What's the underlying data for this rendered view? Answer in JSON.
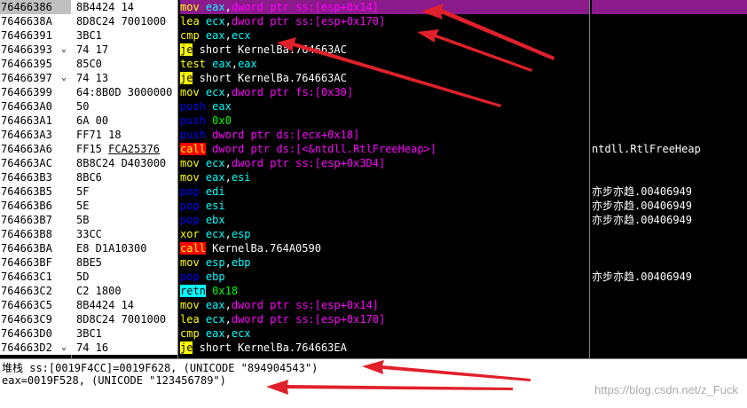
{
  "rows": [
    {
      "addr": "76466386",
      "arrow": "",
      "hex": "8B4424 14",
      "dis": [
        [
          "mov",
          "mn"
        ],
        [
          " ",
          "plain"
        ],
        [
          "eax",
          "op"
        ],
        [
          ",",
          "plain"
        ],
        [
          "dword ptr ss:[esp+0x14]",
          "mem"
        ]
      ],
      "com": "",
      "selected": true
    },
    {
      "addr": "7646638A",
      "arrow": "",
      "hex": "8D8C24 7001000",
      "dis": [
        [
          "lea",
          "mn"
        ],
        [
          " ",
          "plain"
        ],
        [
          "ecx",
          "op"
        ],
        [
          ",",
          "plain"
        ],
        [
          "dword ptr ss:[esp+0x170]",
          "mem"
        ]
      ],
      "com": ""
    },
    {
      "addr": "76466391",
      "arrow": "",
      "hex": "3BC1",
      "dis": [
        [
          "cmp",
          "mn"
        ],
        [
          " ",
          "plain"
        ],
        [
          "eax",
          "op"
        ],
        [
          ",",
          "plain"
        ],
        [
          "ecx",
          "op"
        ]
      ],
      "com": ""
    },
    {
      "addr": "76466393",
      "arrow": "⌄",
      "hex": "74 17",
      "dis": [
        [
          "je",
          "jmp"
        ],
        [
          " short KernelBa.764663AC",
          "plain"
        ]
      ],
      "com": ""
    },
    {
      "addr": "76466395",
      "arrow": "",
      "hex": "85C0",
      "dis": [
        [
          "test",
          "mn"
        ],
        [
          " ",
          "plain"
        ],
        [
          "eax",
          "op"
        ],
        [
          ",",
          "plain"
        ],
        [
          "eax",
          "op"
        ]
      ],
      "com": ""
    },
    {
      "addr": "76466397",
      "arrow": "⌄",
      "hex": "74 13",
      "dis": [
        [
          "je",
          "jmp"
        ],
        [
          " short KernelBa.764663AC",
          "plain"
        ]
      ],
      "com": ""
    },
    {
      "addr": "76466399",
      "arrow": "",
      "hex": "64:8B0D 3000000",
      "dis": [
        [
          "mov",
          "mn"
        ],
        [
          " ",
          "plain"
        ],
        [
          "ecx",
          "op"
        ],
        [
          ",",
          "plain"
        ],
        [
          "dword ptr fs:[0x30]",
          "mem"
        ]
      ],
      "com": ""
    },
    {
      "addr": "764663A0",
      "arrow": "",
      "hex": "50",
      "dis": [
        [
          "push",
          "push"
        ],
        [
          " ",
          "plain"
        ],
        [
          "eax",
          "op"
        ]
      ],
      "com": ""
    },
    {
      "addr": "764663A1",
      "arrow": "",
      "hex": "6A 00",
      "dis": [
        [
          "push",
          "push"
        ],
        [
          " ",
          "plain"
        ],
        [
          "0x0",
          "num"
        ]
      ],
      "com": ""
    },
    {
      "addr": "764663A3",
      "arrow": "",
      "hex": "FF71 18",
      "dis": [
        [
          "push",
          "push"
        ],
        [
          " ",
          "plain"
        ],
        [
          "dword ptr ds:[ecx+0x18]",
          "mem"
        ]
      ],
      "com": ""
    },
    {
      "addr": "764663A6",
      "arrow": "",
      "hex": "FF15 FCA25376",
      "hexul": true,
      "dis": [
        [
          "call",
          "call"
        ],
        [
          " ",
          "plain"
        ],
        [
          "dword ptr ds:[<&ntdll.RtlFreeHeap>]",
          "mem"
        ]
      ],
      "com": "ntdll.RtlFreeHeap"
    },
    {
      "addr": "764663AC",
      "arrow": "",
      "hex": "8B8C24 D403000",
      "dis": [
        [
          "mov",
          "mn"
        ],
        [
          " ",
          "plain"
        ],
        [
          "ecx",
          "op"
        ],
        [
          ",",
          "plain"
        ],
        [
          "dword ptr ss:[esp+0x3D4]",
          "mem"
        ]
      ],
      "com": ""
    },
    {
      "addr": "764663B3",
      "arrow": "",
      "hex": "8BC6",
      "dis": [
        [
          "mov",
          "mn"
        ],
        [
          " ",
          "plain"
        ],
        [
          "eax",
          "op"
        ],
        [
          ",",
          "plain"
        ],
        [
          "esi",
          "op"
        ]
      ],
      "com": ""
    },
    {
      "addr": "764663B5",
      "arrow": "",
      "hex": "5F",
      "dis": [
        [
          "pop",
          "pop"
        ],
        [
          " ",
          "plain"
        ],
        [
          "edi",
          "op"
        ]
      ],
      "com": "亦步亦趋.00406949"
    },
    {
      "addr": "764663B6",
      "arrow": "",
      "hex": "5E",
      "dis": [
        [
          "pop",
          "pop"
        ],
        [
          " ",
          "plain"
        ],
        [
          "esi",
          "op"
        ]
      ],
      "com": "亦步亦趋.00406949"
    },
    {
      "addr": "764663B7",
      "arrow": "",
      "hex": "5B",
      "dis": [
        [
          "pop",
          "pop"
        ],
        [
          " ",
          "plain"
        ],
        [
          "ebx",
          "op"
        ]
      ],
      "com": "亦步亦趋.00406949"
    },
    {
      "addr": "764663B8",
      "arrow": "",
      "hex": "33CC",
      "dis": [
        [
          "xor",
          "mn"
        ],
        [
          " ",
          "plain"
        ],
        [
          "ecx",
          "op"
        ],
        [
          ",",
          "plain"
        ],
        [
          "esp",
          "op"
        ]
      ],
      "com": ""
    },
    {
      "addr": "764663BA",
      "arrow": "",
      "hex": "E8 D1A10300",
      "dis": [
        [
          "call",
          "call"
        ],
        [
          " KernelBa.764A0590",
          "plain"
        ]
      ],
      "com": ""
    },
    {
      "addr": "764663BF",
      "arrow": "",
      "hex": "8BE5",
      "dis": [
        [
          "mov",
          "mn"
        ],
        [
          " ",
          "plain"
        ],
        [
          "esp",
          "op"
        ],
        [
          ",",
          "plain"
        ],
        [
          "ebp",
          "op"
        ]
      ],
      "com": ""
    },
    {
      "addr": "764663C1",
      "arrow": "",
      "hex": "5D",
      "dis": [
        [
          "pop",
          "pop"
        ],
        [
          " ",
          "plain"
        ],
        [
          "ebp",
          "op"
        ]
      ],
      "com": "亦步亦趋.00406949"
    },
    {
      "addr": "764663C2",
      "arrow": "",
      "hex": "C2 1800",
      "dis": [
        [
          "retn",
          "ret"
        ],
        [
          " ",
          "plain"
        ],
        [
          "0x18",
          "num"
        ]
      ],
      "com": ""
    },
    {
      "addr": "764663C5",
      "arrow": "",
      "hex": "8B4424 14",
      "dis": [
        [
          "mov",
          "mn"
        ],
        [
          " ",
          "plain"
        ],
        [
          "eax",
          "op"
        ],
        [
          ",",
          "plain"
        ],
        [
          "dword ptr ss:[esp+0x14]",
          "mem"
        ]
      ],
      "com": ""
    },
    {
      "addr": "764663C9",
      "arrow": "",
      "hex": "8D8C24 7001000",
      "dis": [
        [
          "lea",
          "mn"
        ],
        [
          " ",
          "plain"
        ],
        [
          "ecx",
          "op"
        ],
        [
          ",",
          "plain"
        ],
        [
          "dword ptr ss:[esp+0x170]",
          "mem"
        ]
      ],
      "com": ""
    },
    {
      "addr": "764663D0",
      "arrow": "",
      "hex": "3BC1",
      "dis": [
        [
          "cmp",
          "mn"
        ],
        [
          " ",
          "plain"
        ],
        [
          "eax",
          "op"
        ],
        [
          ",",
          "plain"
        ],
        [
          "ecx",
          "op"
        ]
      ],
      "com": ""
    },
    {
      "addr": "764663D2",
      "arrow": "⌄",
      "hex": "74 16",
      "dis": [
        [
          "je",
          "jmp"
        ],
        [
          " short KernelBa.764663EA",
          "plain"
        ]
      ],
      "com": ""
    }
  ],
  "info": {
    "line1": "堆栈 ss:[0019F4CC]=0019F628, (UNICODE \"894904543\")",
    "line2": "eax=0019F528, (UNICODE \"123456789\")"
  },
  "watermark": "https://blog.csdn.net/z_Fuck",
  "colors": {
    "selected_row": "#8b1a8b",
    "annotation_arrow": "#e0202a"
  }
}
